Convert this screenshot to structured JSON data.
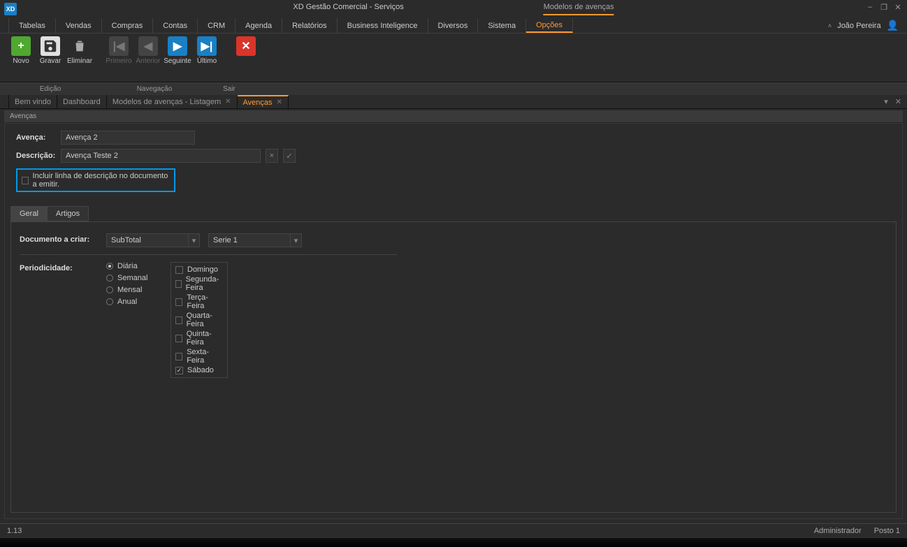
{
  "titlebar": {
    "app_title": "XD Gestão Comercial - Serviços",
    "module_title": "Modelos de avenças"
  },
  "menu": {
    "items": [
      "Tabelas",
      "Vendas",
      "Compras",
      "Contas",
      "CRM",
      "Agenda",
      "Relatórios",
      "Business Inteligence",
      "Diversos",
      "Sistema",
      "Opções"
    ],
    "active_index": 10,
    "user_name": "João Pereira"
  },
  "ribbon": {
    "novo": "Novo",
    "gravar": "Gravar",
    "eliminar": "Eliminar",
    "primeiro": "Primeiro",
    "anterior": "Anterior",
    "seguinte": "Seguinte",
    "ultimo": "Último",
    "sair": "Sair",
    "group_edicao": "Edição",
    "group_navegacao": "Navegação",
    "group_sair": "Sair"
  },
  "tabs": {
    "items": [
      {
        "label": "Bem vindo",
        "closable": false
      },
      {
        "label": "Dashboard",
        "closable": false
      },
      {
        "label": "Modelos de avenças - Listagem",
        "closable": true
      },
      {
        "label": "Avenças",
        "closable": true
      }
    ],
    "active_index": 3
  },
  "section": {
    "title": "Avenças"
  },
  "form": {
    "avenca_label": "Avença:",
    "avenca_value": "Avença 2",
    "descricao_label": "Descrição:",
    "descricao_value": "Avença Teste 2",
    "incluir_label": "Incluir linha de descrição no documento a emitir.",
    "incluir_checked": false
  },
  "inner_tabs": {
    "items": [
      "Geral",
      "Artigos"
    ],
    "active_index": 0
  },
  "panel": {
    "doc_label": "Documento a criar:",
    "doc_value": "SubTotal",
    "serie_value": "Serie 1",
    "period_label": "Periodicidade:",
    "period_options": [
      "Diária",
      "Semanal",
      "Mensal",
      "Anual"
    ],
    "period_selected": 0,
    "days": [
      {
        "label": "Domingo",
        "checked": false
      },
      {
        "label": "Segunda-Feira",
        "checked": false
      },
      {
        "label": "Terça-Feira",
        "checked": false
      },
      {
        "label": "Quarta-Feira",
        "checked": false
      },
      {
        "label": "Quinta-Feira",
        "checked": false
      },
      {
        "label": "Sexta-Feira",
        "checked": false
      },
      {
        "label": "Sábado",
        "checked": true
      }
    ]
  },
  "status": {
    "left": "1.13",
    "admin": "Administrador",
    "posto": "Posto 1"
  }
}
